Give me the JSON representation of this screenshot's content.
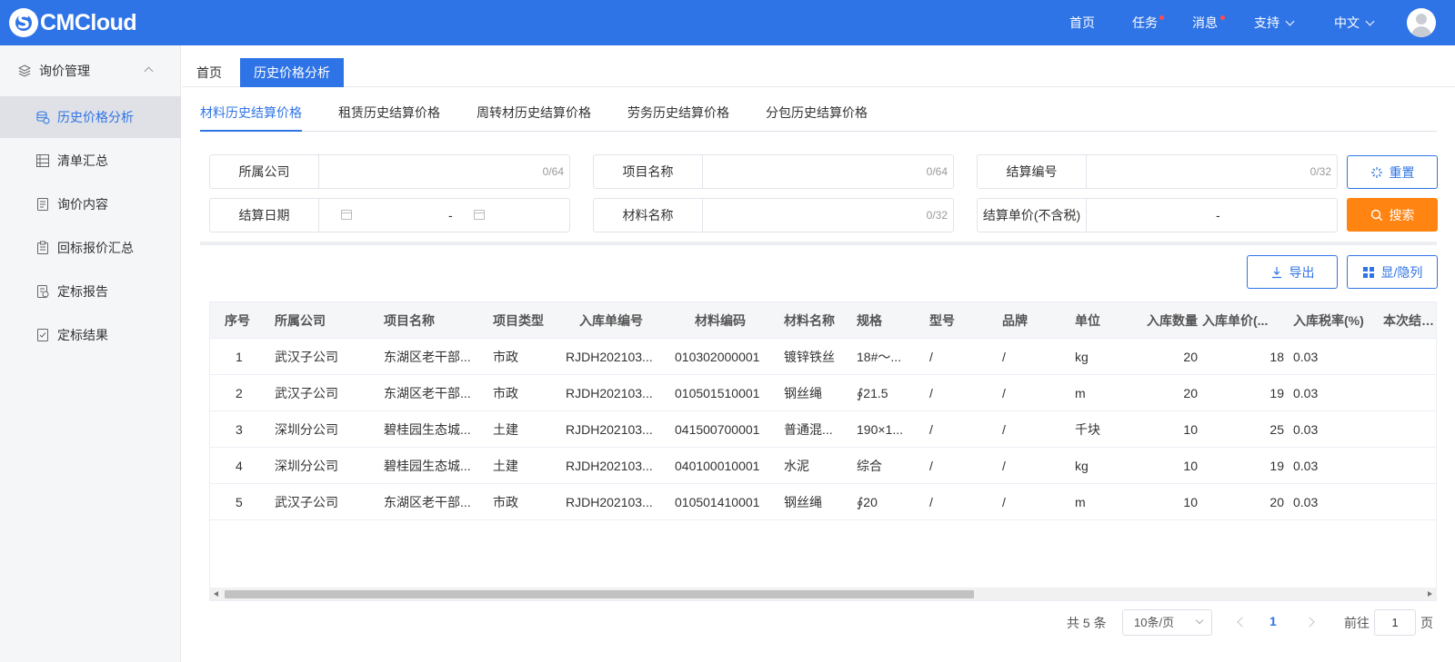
{
  "app": {
    "logo_text": "CMCloud"
  },
  "topnav": {
    "home": "首页",
    "tasks": "任务",
    "messages": "消息",
    "support": "支持",
    "language": "中文"
  },
  "colors": {
    "primary": "#2f74e6",
    "accent_orange": "#ff8412",
    "badge_red": "#ff4d4f"
  },
  "sidebar": {
    "group_label": "询价管理",
    "items": [
      {
        "label": "历史价格分析",
        "icon": "database-icon",
        "active": true
      },
      {
        "label": "清单汇总",
        "icon": "list-icon"
      },
      {
        "label": "询价内容",
        "icon": "document-icon"
      },
      {
        "label": "回标报价汇总",
        "icon": "clipboard-icon"
      },
      {
        "label": "定标报告",
        "icon": "report-icon"
      },
      {
        "label": "定标结果",
        "icon": "result-icon"
      }
    ]
  },
  "page_tabs": [
    "首页",
    "历史价格分析"
  ],
  "sub_tabs": [
    "材料历史结算价格",
    "租赁历史结算价格",
    "周转材历史结算价格",
    "劳务历史结算价格",
    "分包历史结算价格"
  ],
  "filters": {
    "company": {
      "label": "所属公司",
      "counter": "0/64"
    },
    "project_name": {
      "label": "项目名称",
      "counter": "0/64"
    },
    "settle_no": {
      "label": "结算编号",
      "counter": "0/32"
    },
    "settle_date": {
      "label": "结算日期",
      "separator": "-"
    },
    "material_name": {
      "label": "材料名称",
      "counter": "0/32"
    },
    "unit_price": {
      "label": "结算单价(不含税)",
      "separator": "-"
    }
  },
  "buttons": {
    "reset": "重置",
    "search": "搜索",
    "export": "导出",
    "toggle_cols": "显/隐列"
  },
  "table": {
    "headers": [
      "序号",
      "所属公司",
      "项目名称",
      "项目类型",
      "入库单编号",
      "材料编码",
      "材料名称",
      "规格",
      "型号",
      "品牌",
      "单位",
      "入库数量",
      "入库单价(...",
      "入库税率(%)",
      "本次结算..."
    ],
    "rows": [
      [
        "1",
        "武汉子公司",
        "东湖区老干部...",
        "市政",
        "RJDH202103...",
        "010302000001",
        "镀锌铁丝",
        "18#～...",
        "/",
        "/",
        "kg",
        "20",
        "18",
        "0.03",
        ""
      ],
      [
        "2",
        "武汉子公司",
        "东湖区老干部...",
        "市政",
        "RJDH202103...",
        "010501510001",
        "钢丝绳",
        "∮21.5",
        "/",
        "/",
        "m",
        "20",
        "19",
        "0.03",
        ""
      ],
      [
        "3",
        "深圳分公司",
        "碧桂园生态城...",
        "土建",
        "RJDH202103...",
        "041500700001",
        "普通混...",
        "190×1...",
        "/",
        "/",
        "千块",
        "10",
        "25",
        "0.03",
        ""
      ],
      [
        "4",
        "深圳分公司",
        "碧桂园生态城...",
        "土建",
        "RJDH202103...",
        "040100010001",
        "水泥",
        "综合",
        "/",
        "/",
        "kg",
        "10",
        "19",
        "0.03",
        ""
      ],
      [
        "5",
        "武汉子公司",
        "东湖区老干部...",
        "市政",
        "RJDH202103...",
        "010501410001",
        "钢丝绳",
        "∮20",
        "/",
        "/",
        "m",
        "10",
        "20",
        "0.03",
        ""
      ]
    ]
  },
  "pagination": {
    "total": "共 5 条",
    "page_size": "10条/页",
    "current": "1",
    "goto_prefix": "前往",
    "goto_value": "1",
    "goto_suffix": "页"
  }
}
